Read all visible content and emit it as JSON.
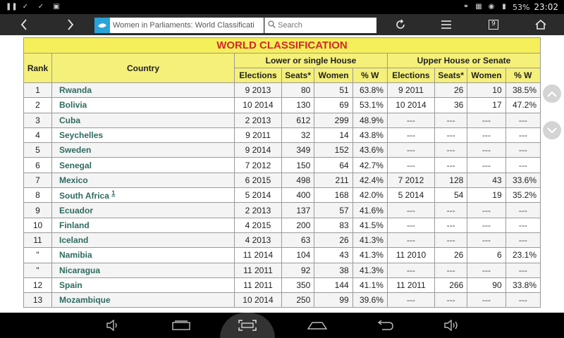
{
  "status_bar": {
    "battery": "53%",
    "time": "23:02"
  },
  "browser": {
    "url_text": "Women in Parliaments: World Classificati",
    "search_placeholder": "Search",
    "tab_count": "9"
  },
  "table": {
    "title": "WORLD CLASSIFICATION",
    "col_rank": "Rank",
    "col_country": "Country",
    "group_lower": "Lower or single House",
    "group_upper": "Upper House or Senate",
    "sub_headers": [
      "Elections",
      "Seats*",
      "Women",
      "% W",
      "Elections",
      "Seats*",
      "Women",
      "% W"
    ],
    "rows": [
      {
        "rank": "1",
        "country": "Rwanda",
        "note": "",
        "l_el": "9 2013",
        "l_seats": "80",
        "l_women": "51",
        "l_pct": "63.8%",
        "u_el": "9 2011",
        "u_seats": "26",
        "u_women": "10",
        "u_pct": "38.5%"
      },
      {
        "rank": "2",
        "country": "Bolivia",
        "note": "",
        "l_el": "10 2014",
        "l_seats": "130",
        "l_women": "69",
        "l_pct": "53.1%",
        "u_el": "10 2014",
        "u_seats": "36",
        "u_women": "17",
        "u_pct": "47.2%"
      },
      {
        "rank": "3",
        "country": "Cuba",
        "note": "",
        "l_el": "2 2013",
        "l_seats": "612",
        "l_women": "299",
        "l_pct": "48.9%",
        "u_el": "---",
        "u_seats": "---",
        "u_women": "---",
        "u_pct": "---"
      },
      {
        "rank": "4",
        "country": "Seychelles",
        "note": "",
        "l_el": "9 2011",
        "l_seats": "32",
        "l_women": "14",
        "l_pct": "43.8%",
        "u_el": "---",
        "u_seats": "---",
        "u_women": "---",
        "u_pct": "---"
      },
      {
        "rank": "5",
        "country": "Sweden",
        "note": "",
        "l_el": "9 2014",
        "l_seats": "349",
        "l_women": "152",
        "l_pct": "43.6%",
        "u_el": "---",
        "u_seats": "---",
        "u_women": "---",
        "u_pct": "---"
      },
      {
        "rank": "6",
        "country": "Senegal",
        "note": "",
        "l_el": "7 2012",
        "l_seats": "150",
        "l_women": "64",
        "l_pct": "42.7%",
        "u_el": "---",
        "u_seats": "---",
        "u_women": "---",
        "u_pct": "---"
      },
      {
        "rank": "7",
        "country": "Mexico",
        "note": "",
        "l_el": "6 2015",
        "l_seats": "498",
        "l_women": "211",
        "l_pct": "42.4%",
        "u_el": "7 2012",
        "u_seats": "128",
        "u_women": "43",
        "u_pct": "33.6%"
      },
      {
        "rank": "8",
        "country": "South Africa",
        "note": "1",
        "l_el": "5 2014",
        "l_seats": "400",
        "l_women": "168",
        "l_pct": "42.0%",
        "u_el": "5 2014",
        "u_seats": "54",
        "u_women": "19",
        "u_pct": "35.2%"
      },
      {
        "rank": "9",
        "country": "Ecuador",
        "note": "",
        "l_el": "2 2013",
        "l_seats": "137",
        "l_women": "57",
        "l_pct": "41.6%",
        "u_el": "---",
        "u_seats": "---",
        "u_women": "---",
        "u_pct": "---"
      },
      {
        "rank": "10",
        "country": "Finland",
        "note": "",
        "l_el": "4 2015",
        "l_seats": "200",
        "l_women": "83",
        "l_pct": "41.5%",
        "u_el": "---",
        "u_seats": "---",
        "u_women": "---",
        "u_pct": "---"
      },
      {
        "rank": "11",
        "country": "Iceland",
        "note": "",
        "l_el": "4 2013",
        "l_seats": "63",
        "l_women": "26",
        "l_pct": "41.3%",
        "u_el": "---",
        "u_seats": "---",
        "u_women": "---",
        "u_pct": "---"
      },
      {
        "rank": "\"",
        "country": "Namibia",
        "note": "",
        "l_el": "11 2014",
        "l_seats": "104",
        "l_women": "43",
        "l_pct": "41.3%",
        "u_el": "11 2010",
        "u_seats": "26",
        "u_women": "6",
        "u_pct": "23.1%"
      },
      {
        "rank": "\"",
        "country": "Nicaragua",
        "note": "",
        "l_el": "11 2011",
        "l_seats": "92",
        "l_women": "38",
        "l_pct": "41.3%",
        "u_el": "---",
        "u_seats": "---",
        "u_women": "---",
        "u_pct": "---"
      },
      {
        "rank": "12",
        "country": "Spain",
        "note": "",
        "l_el": "11 2011",
        "l_seats": "350",
        "l_women": "144",
        "l_pct": "41.1%",
        "u_el": "11 2011",
        "u_seats": "266",
        "u_women": "90",
        "u_pct": "33.8%"
      },
      {
        "rank": "13",
        "country": "Mozambique",
        "note": "",
        "l_el": "10 2014",
        "l_seats": "250",
        "l_women": "99",
        "l_pct": "39.6%",
        "u_el": "---",
        "u_seats": "---",
        "u_women": "---",
        "u_pct": "---"
      }
    ]
  },
  "colors": {
    "title_bg": "#f5f05a",
    "title_text": "#d22a2a",
    "header_bg": "#f5f07a",
    "country_link": "#2e6b60",
    "toolbar_bg": "#2b2b2b"
  }
}
